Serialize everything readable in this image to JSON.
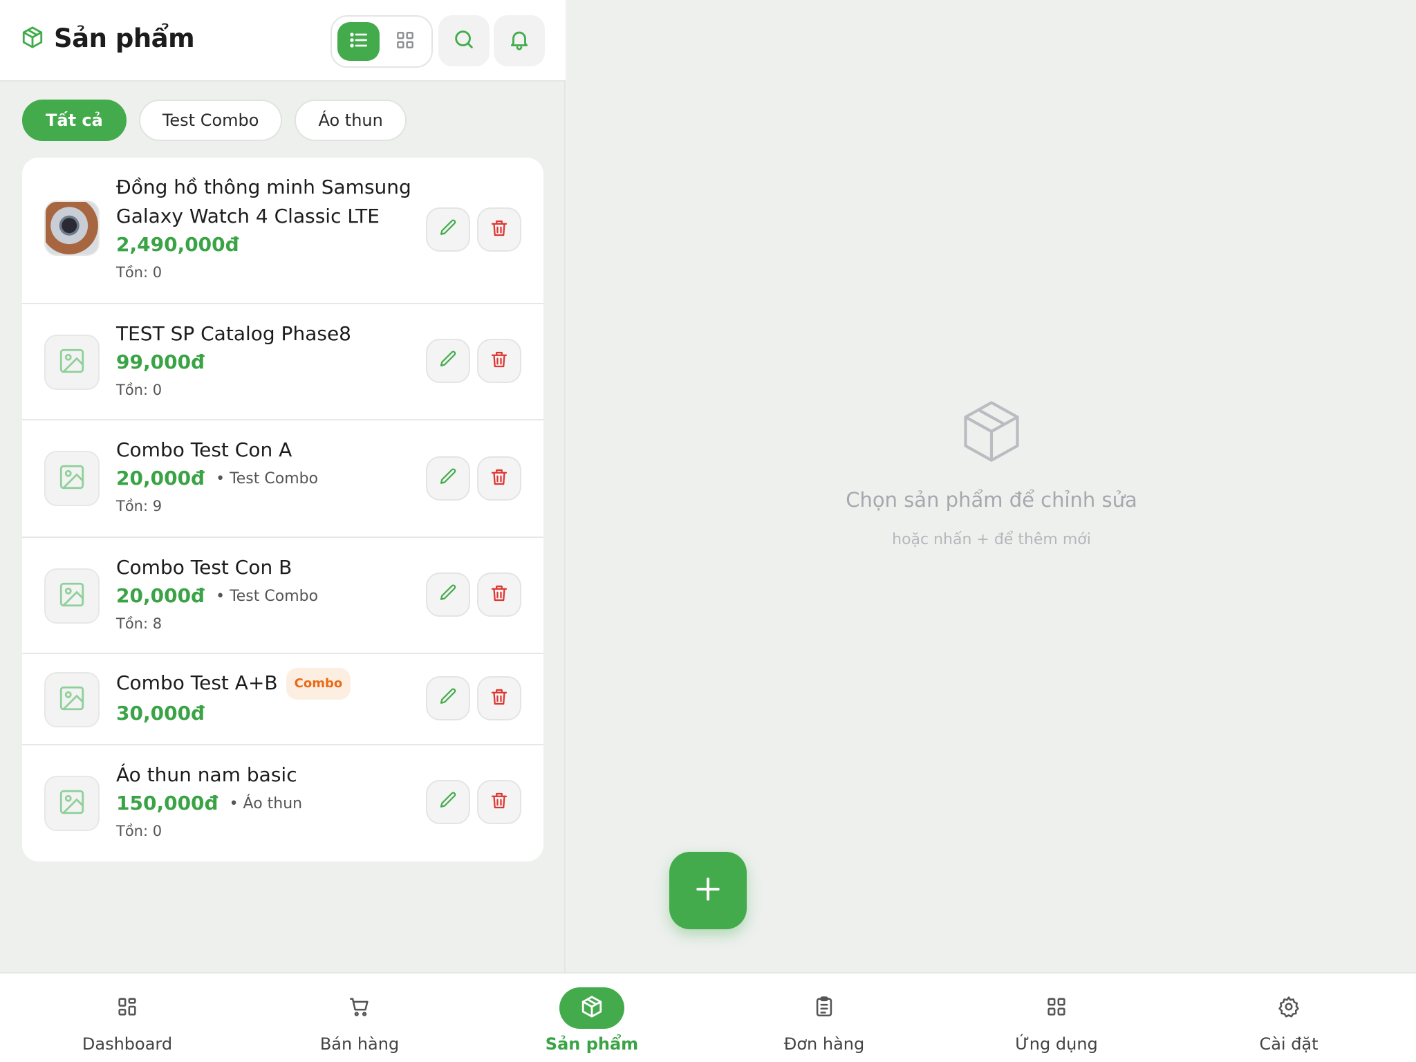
{
  "header": {
    "title": "Sản phẩm"
  },
  "filters": [
    {
      "label": "Tất cả",
      "active": true
    },
    {
      "label": "Test Combo",
      "active": false
    },
    {
      "label": "Áo thun",
      "active": false
    }
  ],
  "products": [
    {
      "name_line1": "Đồng hồ thông minh Samsung",
      "name_line2": "Galaxy Watch 4 Classic LTE",
      "price": "2,490,000đ",
      "stock": "Tồn: 0"
    },
    {
      "name_line1": "TEST SP Catalog Phase8",
      "price": "99,000đ",
      "stock": "Tồn: 0"
    },
    {
      "name_line1": "Combo Test Con A",
      "price": "20,000đ",
      "category": "• Test Combo",
      "stock": "Tồn: 9"
    },
    {
      "name_line1": "Combo Test Con B",
      "price": "20,000đ",
      "category": "• Test Combo",
      "stock": "Tồn: 8"
    },
    {
      "name_line1": "Combo Test A+B",
      "badge": "Combo",
      "price": "30,000đ"
    },
    {
      "name_line1": "Áo thun nam basic",
      "price": "150,000đ",
      "category": "• Áo thun",
      "stock": "Tồn: 0"
    }
  ],
  "empty_state": {
    "title": "Chọn sản phẩm để chỉnh sửa",
    "subtitle": "hoặc nhấn + để thêm mới"
  },
  "nav": [
    {
      "label": "Dashboard",
      "icon": "grid-icon"
    },
    {
      "label": "Bán hàng",
      "icon": "cart-icon"
    },
    {
      "label": "Sản phẩm",
      "icon": "box-icon",
      "active": true
    },
    {
      "label": "Đơn hàng",
      "icon": "clipboard-icon"
    },
    {
      "label": "Ứng dụng",
      "icon": "apps-icon"
    },
    {
      "label": "Cài đặt",
      "icon": "gear-icon"
    }
  ],
  "colors": {
    "accent": "#43ab4c",
    "price": "#3aa345",
    "danger": "#e0342f",
    "badge_bg": "#fdeee2",
    "badge_fg": "#ea6a16"
  }
}
